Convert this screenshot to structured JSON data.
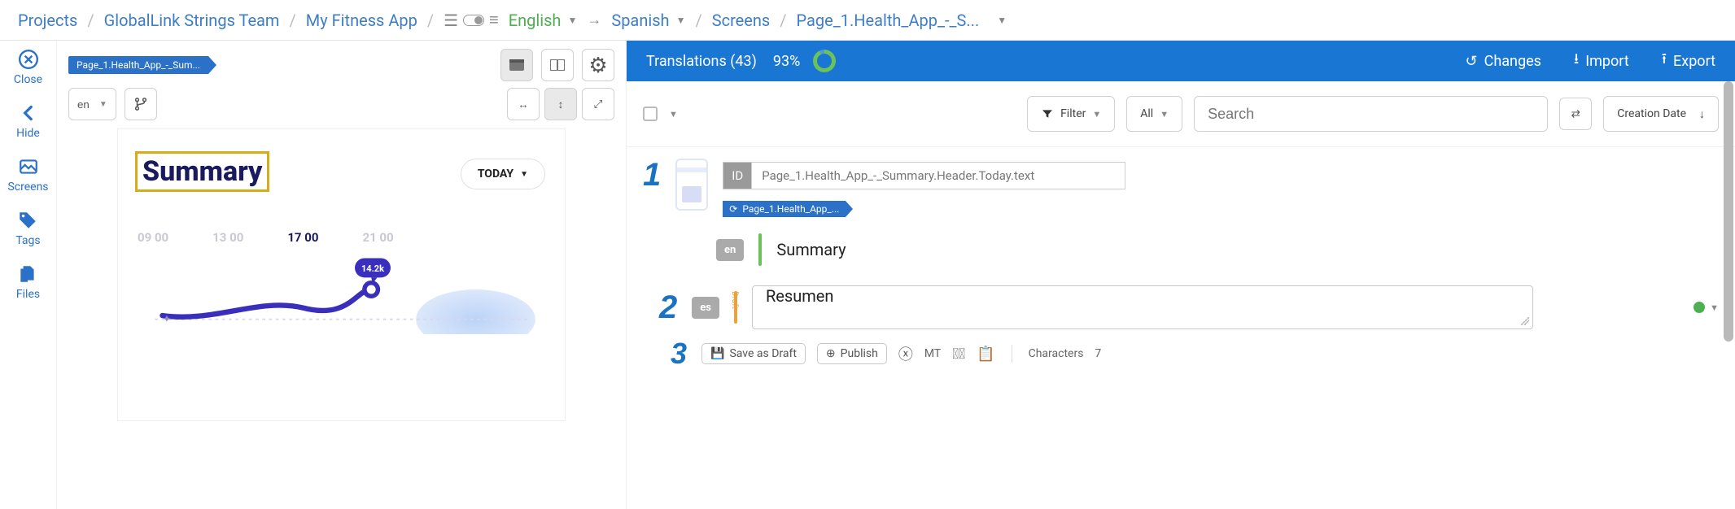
{
  "breadcrumbs": {
    "projects": "Projects",
    "team": "GlobalLink Strings Team",
    "app": "My Fitness App",
    "source_lang": "English",
    "target_lang": "Spanish",
    "screens": "Screens",
    "page": "Page_1.Health_App_-_S..."
  },
  "rail": {
    "close": "Close",
    "hide": "Hide",
    "screens": "Screens",
    "tags": "Tags",
    "files": "Files"
  },
  "preview": {
    "page_chip": "Page_1.Health_App_-_Sum...",
    "lang_selector": "en",
    "mock": {
      "title": "Summary",
      "today_label": "TODAY",
      "times": [
        "09 00",
        "13 00",
        "17 00",
        "21 00"
      ],
      "badge_value": "14.2k"
    }
  },
  "panel": {
    "title": "Translations (43)",
    "percent": "93%",
    "actions": {
      "changes": "Changes",
      "import": "Import",
      "export": "Export"
    }
  },
  "toolbar": {
    "filter": "Filter",
    "all": "All",
    "search_placeholder": "Search",
    "sort": "Creation Date"
  },
  "entry": {
    "id_label": "ID",
    "id_value": "Page_1.Health_App_-_Summary.Header.Today.text",
    "path_chip": "Page_1.Health_App_...",
    "source": {
      "lang": "en",
      "text": "Summary"
    },
    "target": {
      "lang": "es",
      "value": "Resumen",
      "draft_label": "Draft"
    },
    "actions": {
      "save_draft": "Save as Draft",
      "publish": "Publish",
      "mt": "MT",
      "chars_label": "Characters",
      "chars_value": "7"
    },
    "steps": {
      "one": "1",
      "two": "2",
      "three": "3"
    }
  }
}
